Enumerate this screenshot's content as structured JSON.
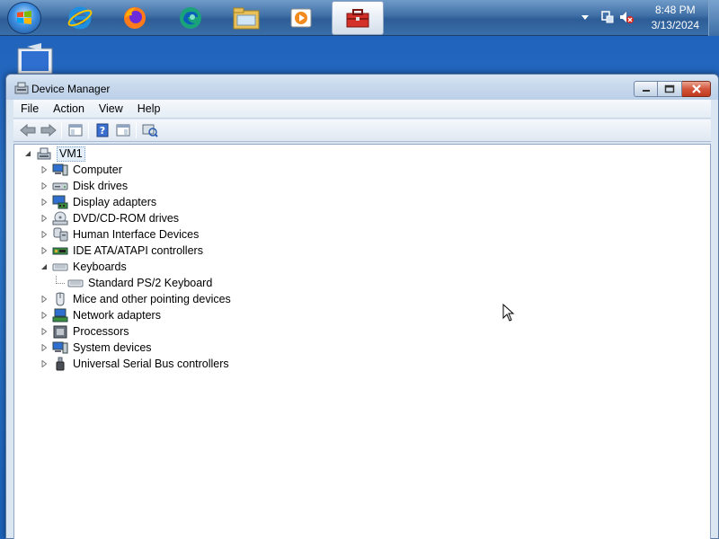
{
  "taskbar": {
    "clock_time": "8:48 PM",
    "clock_date": "3/13/2024",
    "pinned": [
      {
        "name": "internet-explorer-icon"
      },
      {
        "name": "firefox-icon"
      },
      {
        "name": "edge-icon"
      },
      {
        "name": "file-explorer-icon"
      },
      {
        "name": "media-player-icon"
      },
      {
        "name": "toolbox-icon",
        "active": true
      }
    ]
  },
  "window": {
    "title": "Device Manager",
    "menu": [
      "File",
      "Action",
      "View",
      "Help"
    ]
  },
  "tree": {
    "root": "VM1",
    "items": [
      {
        "label": "Computer",
        "icon": "computer-icon",
        "expanded": false
      },
      {
        "label": "Disk drives",
        "icon": "disk-drive-icon",
        "expanded": false
      },
      {
        "label": "Display adapters",
        "icon": "display-adapter-icon",
        "expanded": false
      },
      {
        "label": "DVD/CD-ROM drives",
        "icon": "dvd-drive-icon",
        "expanded": false
      },
      {
        "label": "Human Interface Devices",
        "icon": "hid-icon",
        "expanded": false
      },
      {
        "label": "IDE ATA/ATAPI controllers",
        "icon": "ide-controller-icon",
        "expanded": false
      },
      {
        "label": "Keyboards",
        "icon": "keyboard-icon",
        "expanded": true,
        "children": [
          "Standard PS/2 Keyboard"
        ]
      },
      {
        "label": "Mice and other pointing devices",
        "icon": "mouse-icon",
        "expanded": false
      },
      {
        "label": "Network adapters",
        "icon": "network-adapter-icon",
        "expanded": false
      },
      {
        "label": "Processors",
        "icon": "processor-icon",
        "expanded": false
      },
      {
        "label": "System devices",
        "icon": "system-device-icon",
        "expanded": false
      },
      {
        "label": "Universal Serial Bus controllers",
        "icon": "usb-icon",
        "expanded": false
      }
    ]
  },
  "colors": {
    "desktop": "#2a76cc",
    "window_frame": "#dbe6f3",
    "close_button": "#c03a1d",
    "selection": "#e5effa"
  }
}
